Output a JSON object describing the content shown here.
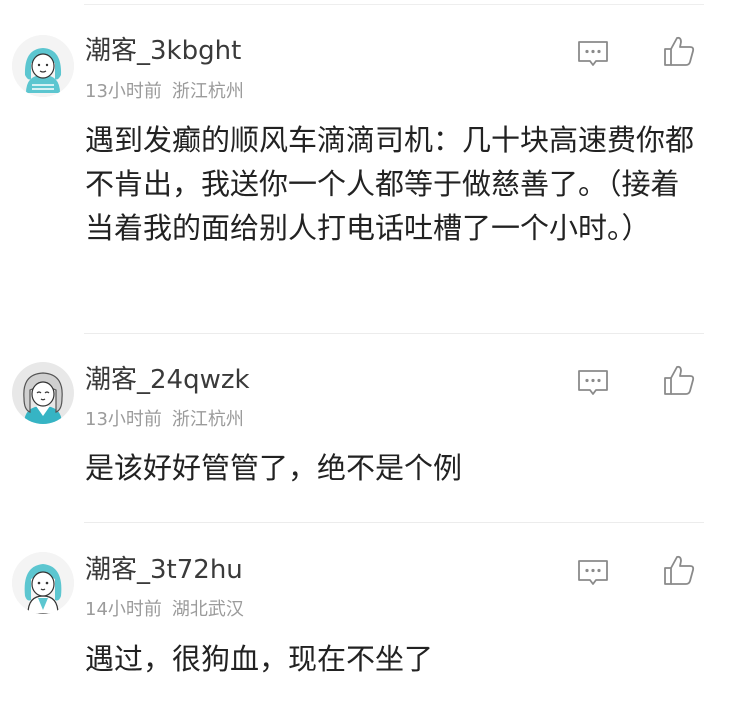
{
  "comments": [
    {
      "username": "潮客_3kbght",
      "time": "13小时前",
      "location": "浙江杭州",
      "content": "遇到发癫的顺风车滴滴司机：几十块高速费你都不肯出，我送你一个人都等于做慈善了。（接着当着我的面给别人打电话吐槽了一个小时。）",
      "avatar_icon": "girl-avatar-icon",
      "reply_icon": "comment-icon",
      "like_icon": "thumbs-up-icon"
    },
    {
      "username": "潮客_24qwzk",
      "time": "13小时前",
      "location": "浙江杭州",
      "content": "是该好好管管了，绝不是个例",
      "avatar_icon": "girl-avatar-icon",
      "reply_icon": "comment-icon",
      "like_icon": "thumbs-up-icon"
    },
    {
      "username": "潮客_3t72hu",
      "time": "14小时前",
      "location": "湖北武汉",
      "content": "遇过，很狗血，现在不坐了",
      "avatar_icon": "girl-avatar-icon",
      "reply_icon": "comment-icon",
      "like_icon": "thumbs-up-icon"
    }
  ],
  "colors": {
    "avatar_teal": "#5cc6d0",
    "avatar_teal_dark": "#36b4c4",
    "icon_gray": "#8a8a8a",
    "meta_gray": "#9b9b9b"
  }
}
